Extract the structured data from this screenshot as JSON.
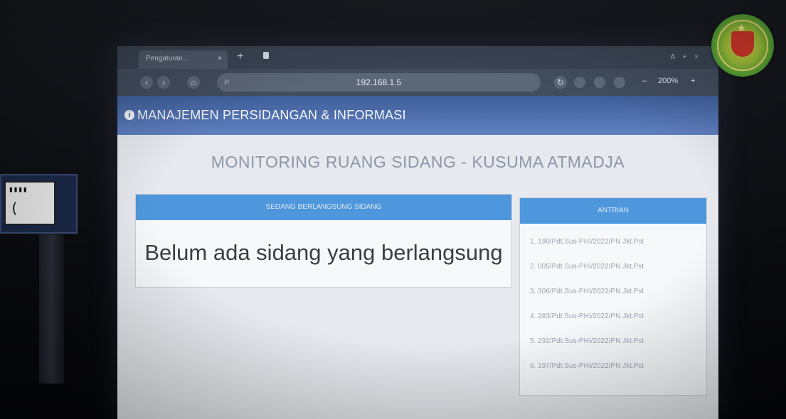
{
  "browser": {
    "tab_title": "Pengaturan...",
    "tab_close": "×",
    "new_tab": "+",
    "url": "192.168.1.5",
    "zoom": "200%",
    "zoom_minus": "–",
    "zoom_plus": "+",
    "window_controls": "A + ×"
  },
  "header": {
    "info_icon": "i",
    "title": "MANAJEMEN PERSIDANGAN & INFORMASI"
  },
  "main": {
    "page_title": "MONITORING RUANG SIDANG - KUSUMA ATMADJA"
  },
  "current_panel": {
    "heading": "SEDANG BERLANGSUNG SIDANG",
    "message": "Belum ada sidang yang berlangsung"
  },
  "queue_panel": {
    "heading": "ANTRIAN",
    "items": [
      "1. 190/Pdt.Sus-PHI/2022/PN Jkt.Pst",
      "2. 005/Pdt.Sus-PHI/2022/PN Jkt.Pst",
      "3. 306/Pdt.Sus-PHI/2022/PN Jkt.Pst",
      "4. 283/Pdt.Sus-PHI/2022/PN Jkt.Pst",
      "5. 232/Pdt.Sus-PHI/2022/PN Jkt.Pst",
      "6. 197/Pdt.Sus-PHI/2022/PN Jkt.Pst"
    ]
  },
  "side_label": {
    "line1": "▮▮▮▮",
    "line2": "("
  },
  "colors": {
    "header_blue": "#4f6fae",
    "panel_blue": "#4f97dc",
    "seal_green": "#3f9a35"
  }
}
